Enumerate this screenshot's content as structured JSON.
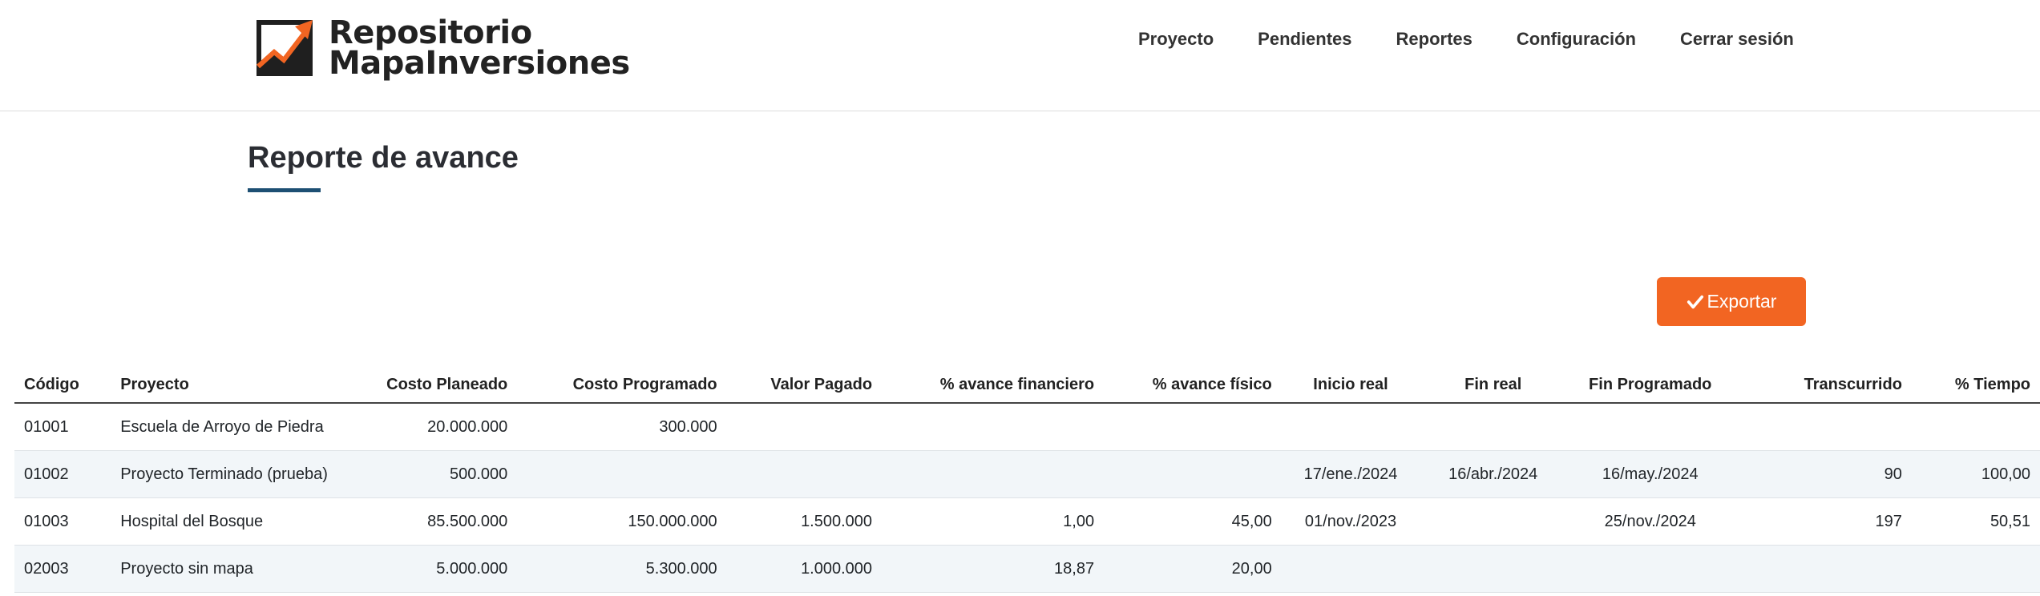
{
  "header": {
    "logo_line1": "Repositorio",
    "logo_line2": "MapaInversiones",
    "nav": [
      "Proyecto",
      "Pendientes",
      "Reportes",
      "Configuración",
      "Cerrar sesión"
    ]
  },
  "page": {
    "title": "Reporte de avance",
    "export_label": "Exportar"
  },
  "table": {
    "columns": [
      "Código",
      "Proyecto",
      "Costo Planeado",
      "Costo Programado",
      "Valor Pagado",
      "% avance financiero",
      "% avance físico",
      "Inicio real",
      "Fin real",
      "Fin Programado",
      "Transcurrido",
      "% Tiempo"
    ],
    "rows": [
      [
        "01001",
        "Escuela de Arroyo de Piedra",
        "20.000.000",
        "300.000",
        "",
        "",
        "",
        "",
        "",
        "",
        "",
        ""
      ],
      [
        "01002",
        "Proyecto Terminado (prueba)",
        "500.000",
        "",
        "",
        "",
        "",
        "17/ene./2024",
        "16/abr./2024",
        "16/may./2024",
        "90",
        "100,00"
      ],
      [
        "01003",
        "Hospital del Bosque",
        "85.500.000",
        "150.000.000",
        "1.500.000",
        "1,00",
        "45,00",
        "01/nov./2023",
        "",
        "25/nov./2024",
        "197",
        "50,51"
      ],
      [
        "02003",
        "Proyecto sin mapa",
        "5.000.000",
        "5.300.000",
        "1.000.000",
        "18,87",
        "20,00",
        "",
        "",
        "",
        "",
        ""
      ]
    ]
  },
  "colors": {
    "accent_orange": "#f26522",
    "title_underline": "#1d4f73",
    "row_stripe": "#f2f6f9"
  },
  "icons": {
    "logo": "chart-arrow-logo-icon",
    "export": "check-icon"
  }
}
